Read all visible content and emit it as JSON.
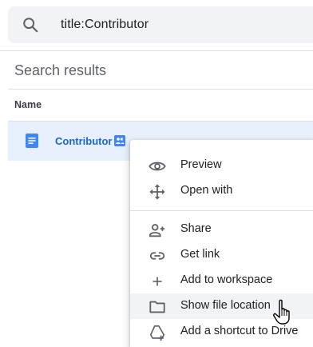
{
  "search": {
    "query": "title:Contributor",
    "icon": "search-icon"
  },
  "results": {
    "title": "Search results",
    "column_header": "Name",
    "rows": [
      {
        "name": "Contributor",
        "type_icon": "docs-icon",
        "shared_icon": "shared-people-icon",
        "selected": true
      }
    ]
  },
  "context_menu": {
    "items": [
      {
        "label": "Preview",
        "icon": "eye-icon"
      },
      {
        "label": "Open with",
        "icon": "open-with-icon"
      },
      {
        "label": "Share",
        "icon": "person-add-icon"
      },
      {
        "label": "Get link",
        "icon": "link-icon"
      },
      {
        "label": "Add to workspace",
        "icon": "plus-icon"
      },
      {
        "label": "Show file location",
        "icon": "folder-icon",
        "hovered": true
      },
      {
        "label": "Add a shortcut to Drive",
        "icon": "shortcut-icon"
      }
    ]
  },
  "colors": {
    "selection": "#e8f0fe",
    "link_blue": "#1967d2",
    "docs_blue": "#4285f4",
    "icon_gray": "#5f6368"
  }
}
